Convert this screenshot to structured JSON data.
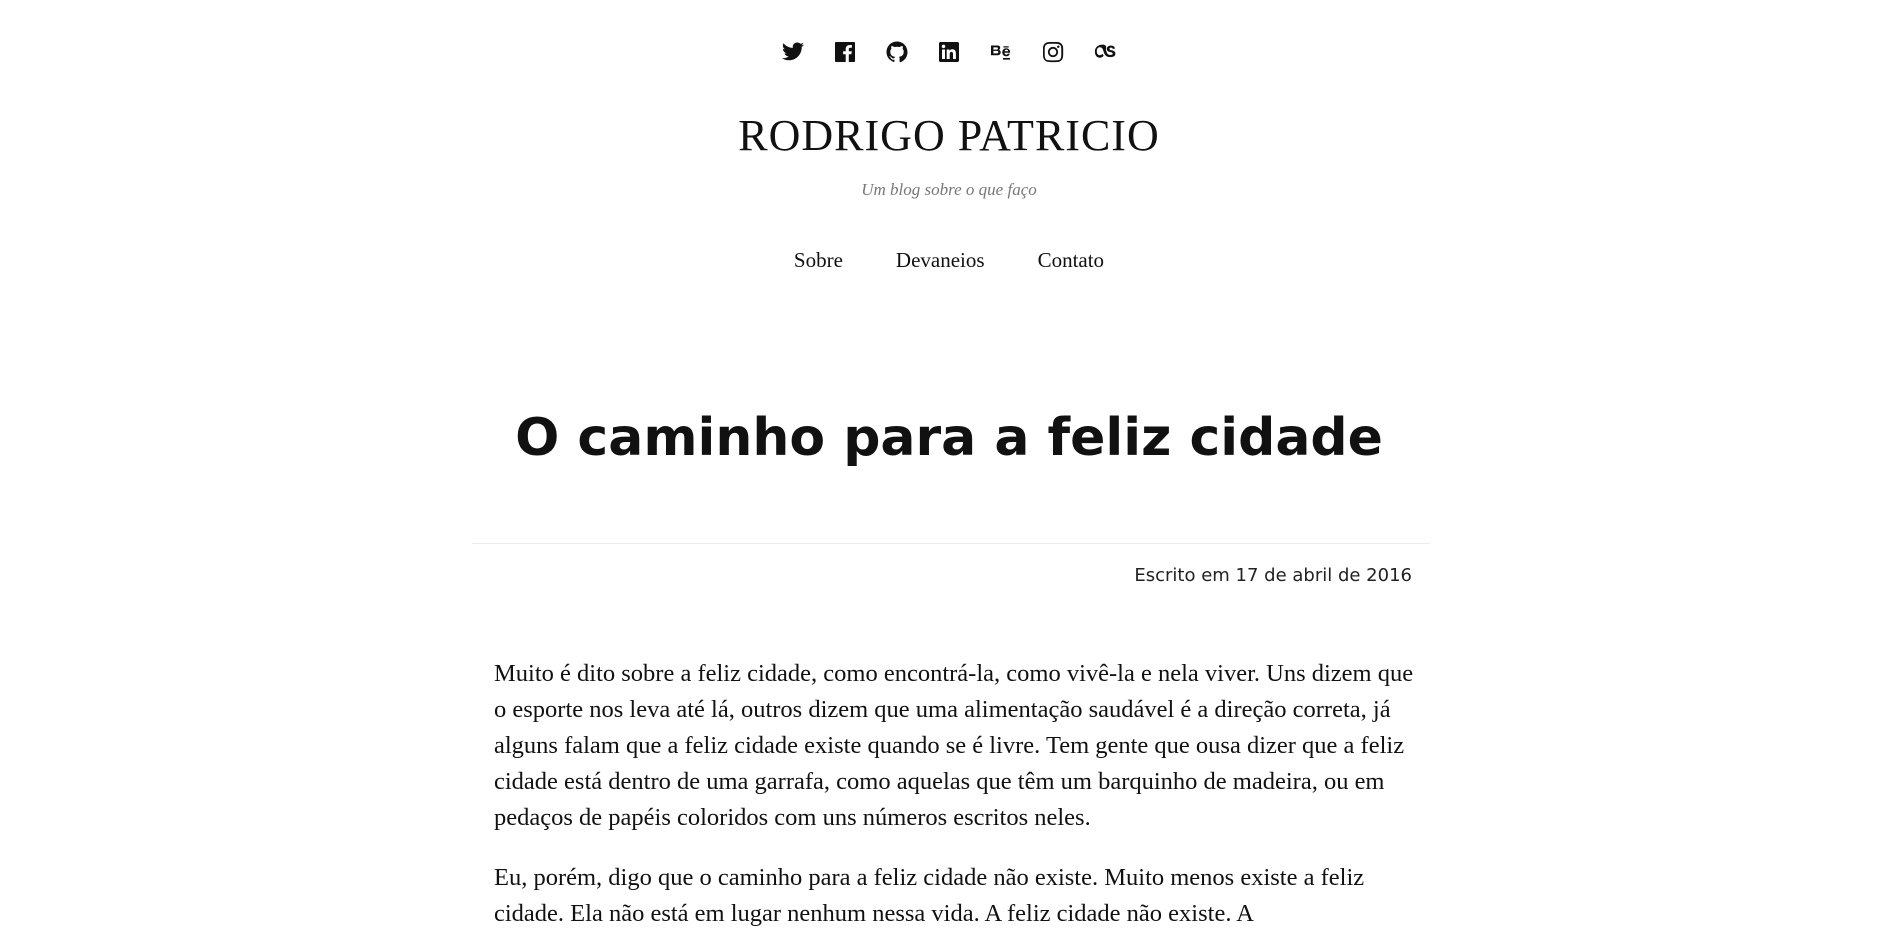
{
  "social": [
    {
      "name": "twitter",
      "icon": "twitter-icon"
    },
    {
      "name": "facebook",
      "icon": "facebook-icon"
    },
    {
      "name": "github",
      "icon": "github-icon"
    },
    {
      "name": "linkedin",
      "icon": "linkedin-icon"
    },
    {
      "name": "behance",
      "icon": "behance-icon"
    },
    {
      "name": "instagram",
      "icon": "instagram-icon"
    },
    {
      "name": "lastfm",
      "icon": "lastfm-icon"
    }
  ],
  "header": {
    "title": "RODRIGO PATRICIO",
    "tagline": "Um blog sobre o que faço"
  },
  "nav": {
    "items": [
      "Sobre",
      "Devaneios",
      "Contato"
    ]
  },
  "post": {
    "title": "O caminho para a feliz cidade",
    "date": "Escrito em 17 de abril de 2016",
    "paragraphs": [
      "Muito é dito sobre a feliz cidade, como encontrá-la, como vivê-la e nela viver. Uns dizem que o esporte nos leva até lá, outros dizem que uma alimentação saudável é a direção correta, já alguns falam que a feliz cidade existe quando se é livre. Tem gente que ousa dizer que a feliz cidade está dentro de uma garrafa, como aquelas que têm um barquinho de madeira, ou em pedaços de papéis coloridos com uns números escritos neles.",
      "Eu, porém, digo que o caminho para a feliz cidade não existe. Muito menos existe a feliz cidade. Ela não está em lugar nenhum nessa vida. A feliz cidade não existe. A"
    ]
  },
  "colors": {
    "text": "#111111",
    "tagline": "#777777",
    "divider": "#ececec",
    "background": "#ffffff"
  }
}
